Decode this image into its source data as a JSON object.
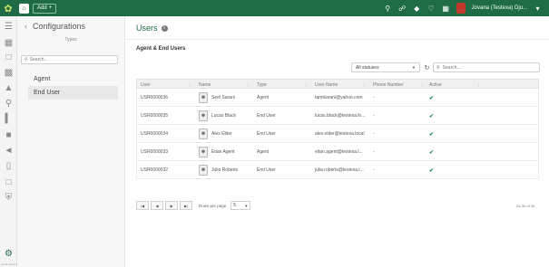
{
  "topbar": {
    "logo_icon": "leaf-logo",
    "add_label": "Add",
    "user_name": "Jovana (Testexa) Dju...",
    "icons": [
      "search-icon",
      "headset-icon",
      "tag-icon",
      "heart-icon",
      "calendar-icon"
    ]
  },
  "rail": {
    "icons": [
      "tree-list-icon",
      "grid-icon",
      "info-box-icon",
      "calculator-icon",
      "graduation-cap-icon",
      "magnifier-icon",
      "bar-chart-icon",
      "comment-icon",
      "megaphone-icon",
      "mobile-icon",
      "document-icon",
      "shield-icon"
    ],
    "settings_icon": "gear-icon",
    "version": "cloud.sai/v1.168.8"
  },
  "config": {
    "title": "Configurations",
    "types_label": "Types",
    "search_placeholder": "Search...",
    "types": [
      {
        "label": "Agent",
        "active": false
      },
      {
        "label": "End User",
        "active": true
      }
    ]
  },
  "main": {
    "title": "Users",
    "section_title": "Agent & End Users",
    "status_filter": "All statuses",
    "search_placeholder": "Search..."
  },
  "table": {
    "columns": [
      "User",
      "Name",
      "Type",
      "User Name",
      "Phone Number",
      "Active"
    ],
    "rows": [
      {
        "user": "USR0000036",
        "name": "Seel Sarani",
        "type": "Agent",
        "username": "tamikarani@yahoo.com",
        "phone": "-",
        "active": true
      },
      {
        "user": "USR0000035",
        "name": "Lucas Black",
        "type": "End User",
        "username": "lucas.black@testexa.lo...",
        "phone": "-",
        "active": true
      },
      {
        "user": "USR0000034",
        "name": "Alex Elder",
        "type": "End User",
        "username": "alex.elder@testexa.local",
        "phone": "-",
        "active": true
      },
      {
        "user": "USR0000033",
        "name": "Eitan Agent",
        "type": "Agent",
        "username": "eitan.agent@testexa.l...",
        "phone": "-",
        "active": true
      },
      {
        "user": "USR0000032",
        "name": "Julia Roberts",
        "type": "End User",
        "username": "julia.roberts@testexa.l...",
        "phone": "-",
        "active": true
      }
    ]
  },
  "pager": {
    "first": "|◀",
    "prev": "◀",
    "next": "▶",
    "last": "▶|",
    "rows_per_page_label": "Rows per page",
    "rows_per_page": "5",
    "range": "26-30 of 36"
  },
  "colors": {
    "brand": "#1f6b45",
    "accent_check": "#1f8a5a"
  }
}
